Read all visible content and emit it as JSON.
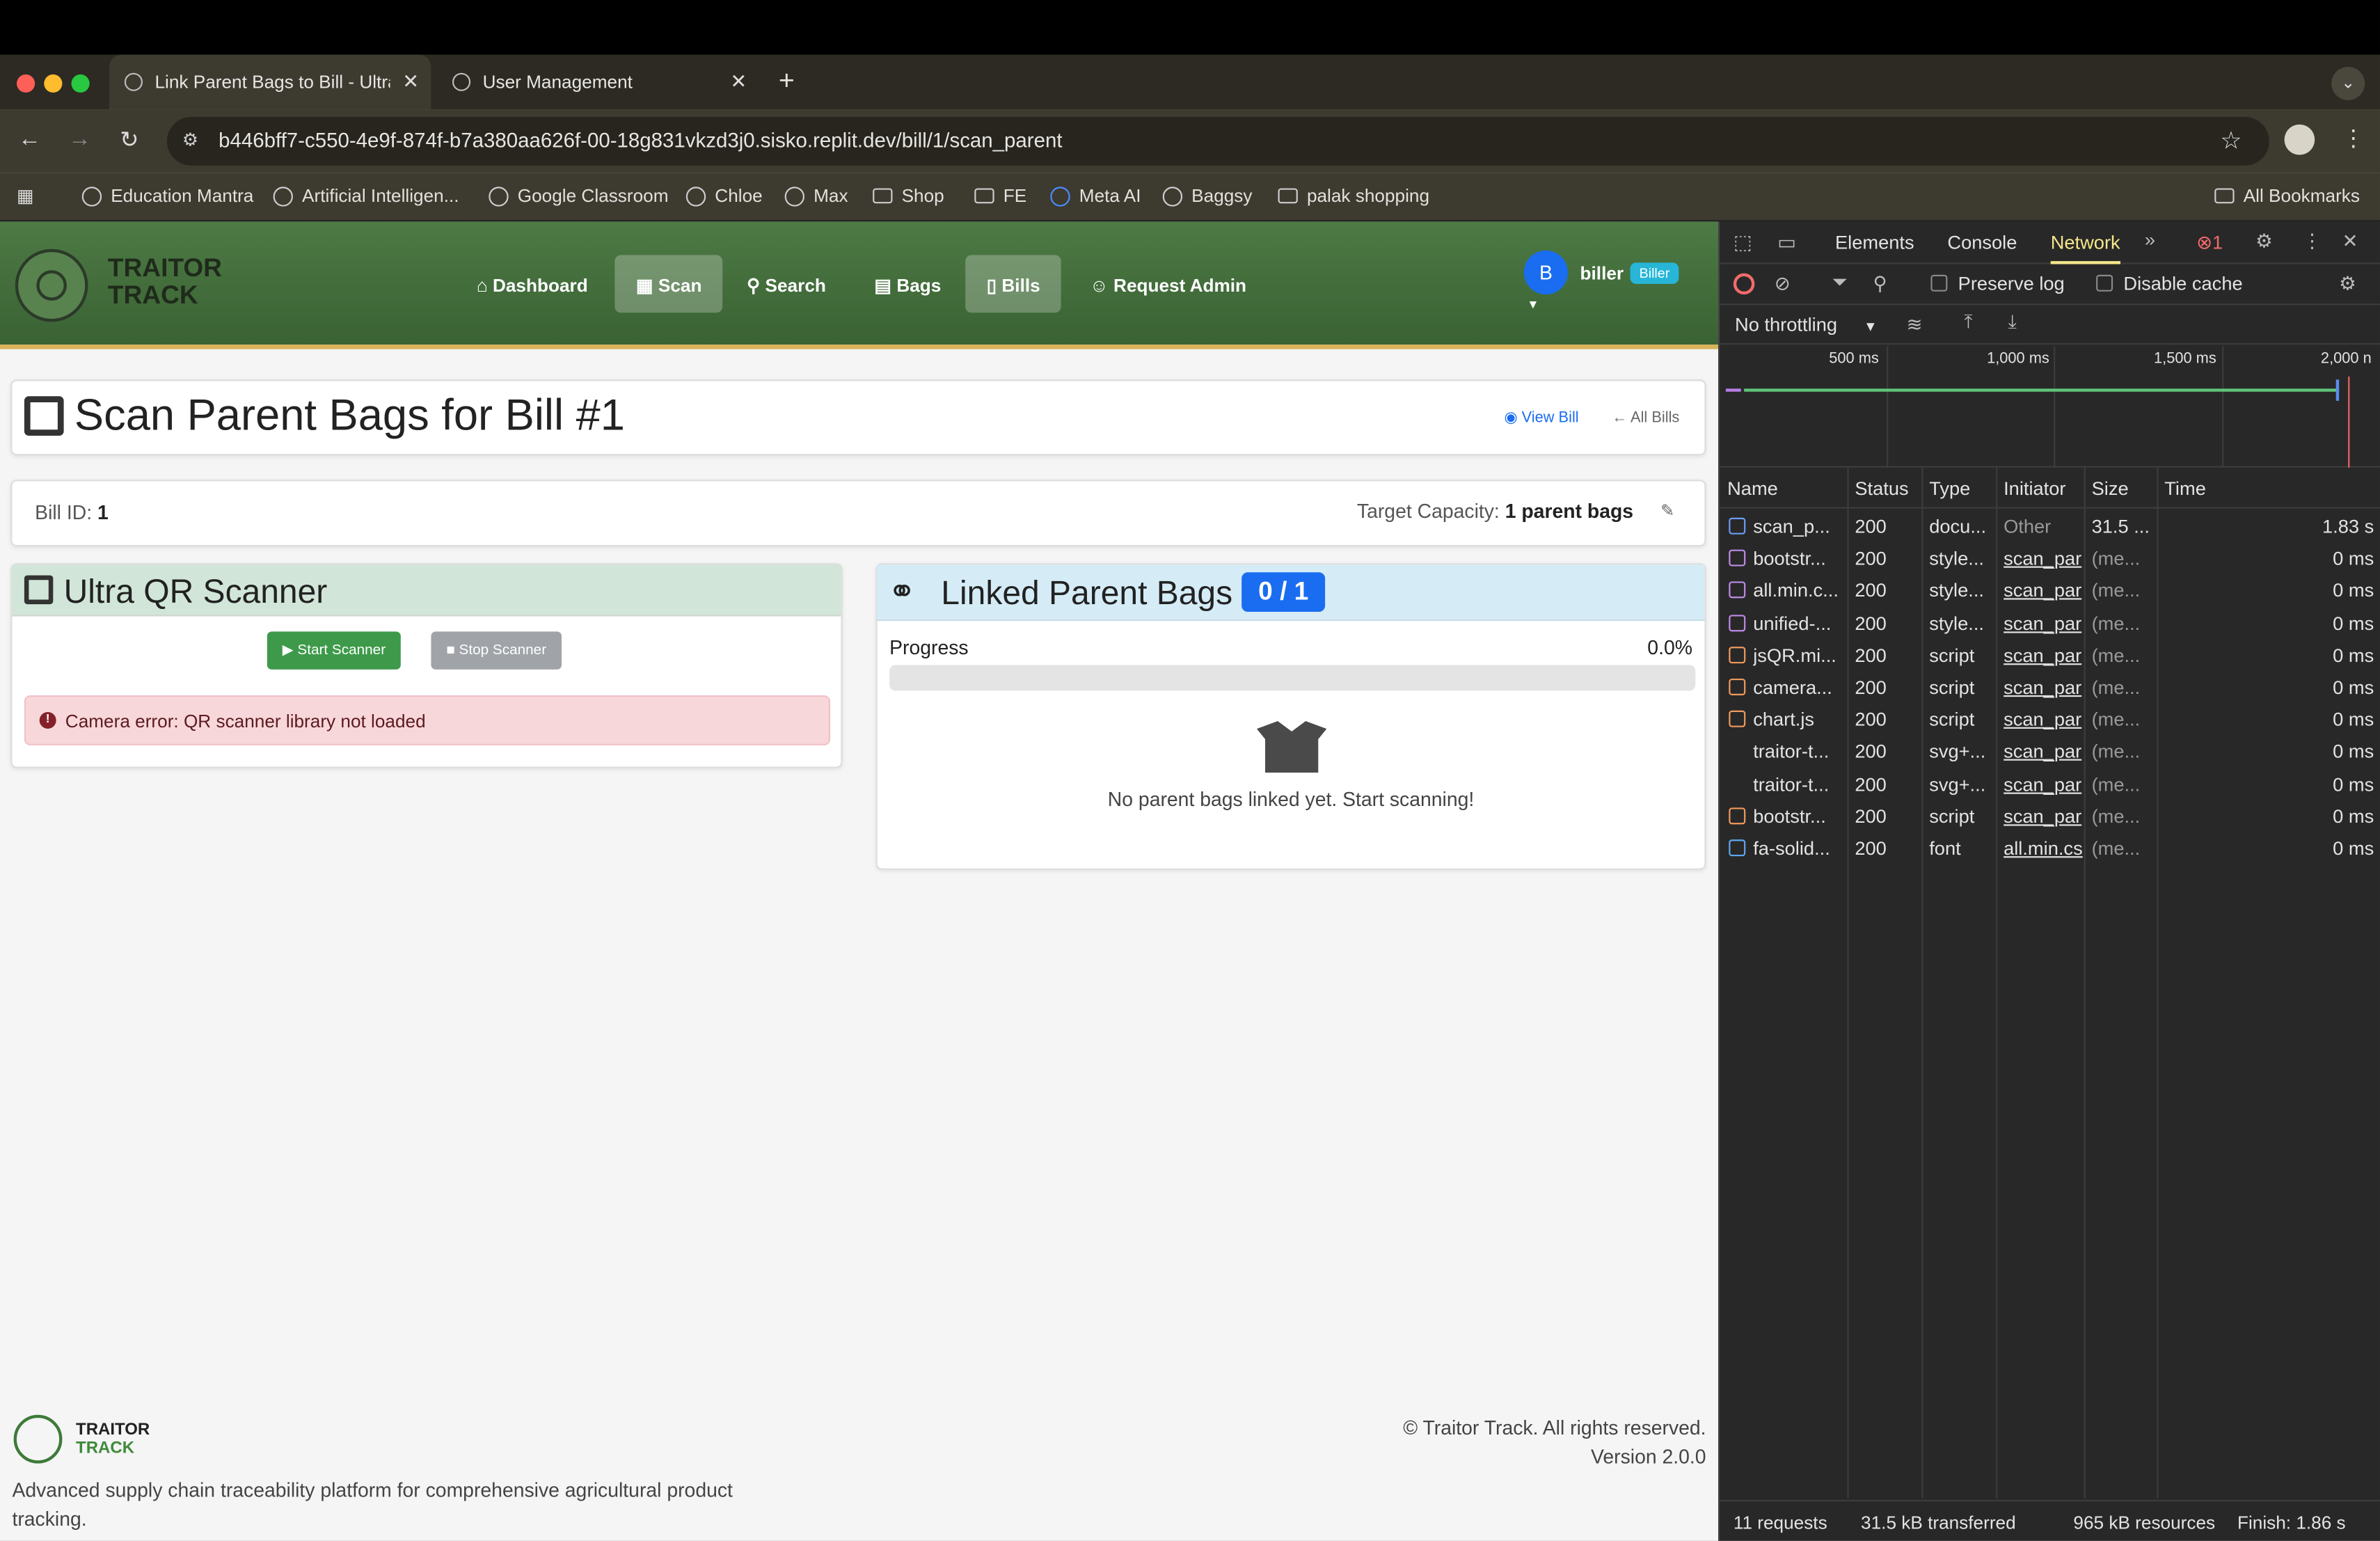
{
  "browser": {
    "tabs": [
      {
        "title": "Link Parent Bags to Bill - Ultra"
      },
      {
        "title": "User Management"
      }
    ],
    "new_tab": "+",
    "url": "b446bff7-c550-4e9f-874f-b7a380aa626f-00-18g831vkzd3j0.sisko.replit.dev/bill/1/scan_parent",
    "bookmarks": [
      "Education Mantra",
      "Artificial Intelligen...",
      "Google Classroom",
      "Chloe",
      "Max",
      "Shop",
      "FE",
      "Meta AI",
      "Baggsy",
      "palak shopping"
    ],
    "all_bookmarks": "All Bookmarks"
  },
  "app": {
    "brand_line1": "TRAITOR",
    "brand_line2": "TRACK",
    "nav": [
      "Dashboard",
      "Scan",
      "Search",
      "Bags",
      "Bills",
      "Request Admin"
    ],
    "user": {
      "initial": "B",
      "name": "biller",
      "role": "Biller"
    },
    "page_title": "Scan Parent Bags for Bill #1",
    "view_bill": "View Bill",
    "all_bills": "All Bills",
    "bill_id_label": "Bill ID:",
    "bill_id": "1",
    "capacity_label": "Target Capacity:",
    "capacity_value": "1 parent bags",
    "scanner_title": "Ultra QR Scanner",
    "start_scanner": "Start Scanner",
    "stop_scanner": "Stop Scanner",
    "camera_error": "Camera error: QR scanner library not loaded",
    "linked_title": "Linked Parent Bags",
    "linked_count": "0 / 1",
    "progress_label": "Progress",
    "progress_value": "0.0%",
    "progress_fraction": 0.0,
    "empty_msg": "No parent bags linked yet. Start scanning!",
    "footer_brand1": "TRAITOR",
    "footer_brand2": "TRACK",
    "footer_desc": "Advanced supply chain traceability platform for comprehensive agricultural product tracking.",
    "copyright": "© Traitor Track. All rights reserved.",
    "version": "Version 2.0.0"
  },
  "devtools": {
    "tabs": [
      "Elements",
      "Console",
      "Network"
    ],
    "error_count": "1",
    "preserve_log": "Preserve log",
    "disable_cache": "Disable cache",
    "throttling": "No throttling",
    "timeline_ticks": [
      "500 ms",
      "1,000 ms",
      "1,500 ms",
      "2,000 n"
    ],
    "columns": [
      "Name",
      "Status",
      "Type",
      "Initiator",
      "Size",
      "Time"
    ],
    "rows": [
      {
        "name": "scan_p...",
        "status": "200",
        "type": "docu...",
        "initiator": "Other",
        "size": "31.5 ...",
        "time": "1.83 s",
        "icon": "doc-icon"
      },
      {
        "name": "bootstr...",
        "status": "200",
        "type": "style...",
        "initiator": "scan_par",
        "size": "(me...",
        "time": "0 ms",
        "icon": "style-icon"
      },
      {
        "name": "all.min.c...",
        "status": "200",
        "type": "style...",
        "initiator": "scan_par",
        "size": "(me...",
        "time": "0 ms",
        "icon": "style-icon"
      },
      {
        "name": "unified-...",
        "status": "200",
        "type": "style...",
        "initiator": "scan_par",
        "size": "(me...",
        "time": "0 ms",
        "icon": "style-icon"
      },
      {
        "name": "jsQR.mi...",
        "status": "200",
        "type": "script",
        "initiator": "scan_par",
        "size": "(me...",
        "time": "0 ms",
        "icon": "script-icon"
      },
      {
        "name": "camera...",
        "status": "200",
        "type": "script",
        "initiator": "scan_par",
        "size": "(me...",
        "time": "0 ms",
        "icon": "script-icon"
      },
      {
        "name": "chart.js",
        "status": "200",
        "type": "script",
        "initiator": "scan_par",
        "size": "(me...",
        "time": "0 ms",
        "icon": "script-icon"
      },
      {
        "name": "traitor-t...",
        "status": "200",
        "type": "svg+...",
        "initiator": "scan_par",
        "size": "(me...",
        "time": "0 ms",
        "icon": "image-icon"
      },
      {
        "name": "traitor-t...",
        "status": "200",
        "type": "svg+...",
        "initiator": "scan_par",
        "size": "(me...",
        "time": "0 ms",
        "icon": "image-icon"
      },
      {
        "name": "bootstr...",
        "status": "200",
        "type": "script",
        "initiator": "scan_par",
        "size": "(me...",
        "time": "0 ms",
        "icon": "script-icon"
      },
      {
        "name": "fa-solid...",
        "status": "200",
        "type": "font",
        "initiator": "all.min.cs",
        "size": "(me...",
        "time": "0 ms",
        "icon": "font-icon"
      }
    ],
    "summary": [
      "11 requests",
      "31.5 kB transferred",
      "965 kB resources",
      "Finish: 1.86 s"
    ]
  },
  "colors": {
    "nav_green": "#3f6a38",
    "accent_blue": "#1a6df0",
    "error_bg": "#f7d7da",
    "start_green": "#3e9a4a"
  }
}
